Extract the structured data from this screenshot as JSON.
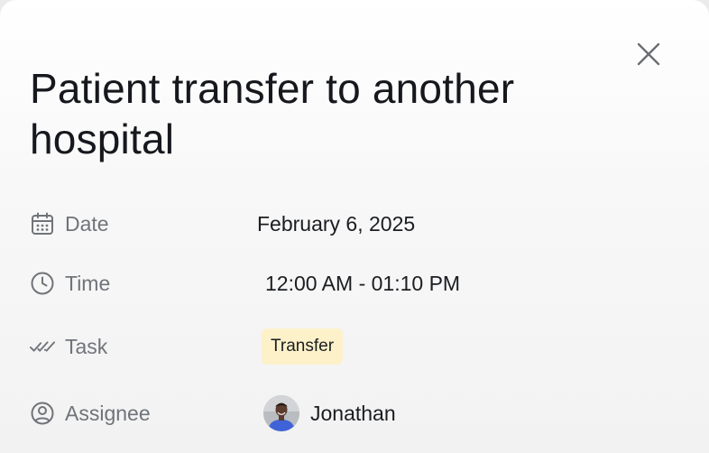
{
  "title": "Patient transfer to another hospital",
  "details": {
    "date": {
      "label": "Date",
      "icon": "calendar-icon",
      "value": "February 6, 2025"
    },
    "time": {
      "label": "Time",
      "icon": "clock-icon",
      "value": "12:00 AM - 01:10 PM"
    },
    "task": {
      "label": "Task",
      "icon": "double-check-icon",
      "value": "Transfer",
      "badge_color": "#fdf1c9"
    },
    "assignee": {
      "label": "Assignee",
      "icon": "user-circle-icon",
      "value": "Jonathan"
    }
  },
  "close_icon": "close-icon"
}
